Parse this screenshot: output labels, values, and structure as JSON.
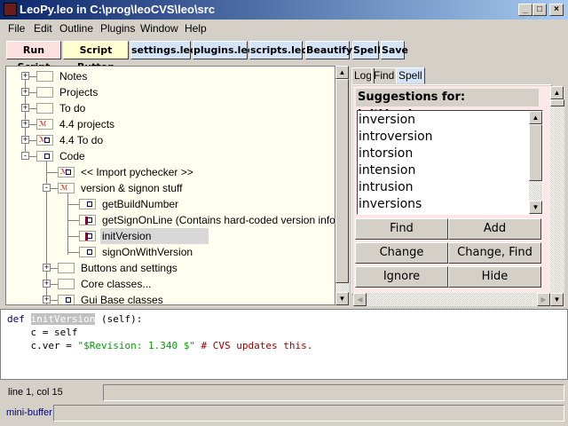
{
  "window": {
    "title": "LeoPy.leo in C:\\prog\\leoCVS\\leo\\src",
    "controls": {
      "minimize": "_",
      "maximize": "□",
      "close": "×"
    }
  },
  "menu": [
    "File",
    "Edit",
    "Outline",
    "Plugins",
    "Window",
    "Help"
  ],
  "toolbar": [
    {
      "label": "Run Script",
      "color": "#fce0e0"
    },
    {
      "label": "Script Button",
      "color": "#ffffd0"
    },
    {
      "label": "settings.leo",
      "color": "#d4e4f8"
    },
    {
      "label": "plugins.leo",
      "color": "#d4e4f8"
    },
    {
      "label": "scripts.leo",
      "color": "#d4e4f8"
    },
    {
      "label": "Beautify",
      "color": "#d4e4f8"
    },
    {
      "label": "Spell",
      "color": "#d4e4f8"
    },
    {
      "label": "Save",
      "color": "#d4e4f8"
    }
  ],
  "outline": [
    {
      "label": "Notes",
      "level": 0,
      "expander": "+",
      "clone": false,
      "body": false,
      "marked": false
    },
    {
      "label": "Projects",
      "level": 0,
      "expander": "+",
      "clone": false,
      "body": false,
      "marked": false
    },
    {
      "label": "To do",
      "level": 0,
      "expander": "+",
      "clone": false,
      "body": false,
      "marked": false
    },
    {
      "label": "4.4 projects",
      "level": 0,
      "expander": "+",
      "clone": true,
      "body": false,
      "marked": false
    },
    {
      "label": "4.4 To do",
      "level": 0,
      "expander": "+",
      "clone": true,
      "body": true,
      "marked": false
    },
    {
      "label": "Code",
      "level": 0,
      "expander": "-",
      "clone": false,
      "body": true,
      "marked": false
    },
    {
      "label": "<< Import pychecker >>",
      "level": 1,
      "expander": "",
      "clone": true,
      "body": true,
      "marked": false
    },
    {
      "label": "version & signon stuff",
      "level": 1,
      "expander": "-",
      "clone": true,
      "body": false,
      "marked": false
    },
    {
      "label": "getBuildNumber",
      "level": 2,
      "expander": "",
      "clone": false,
      "body": true,
      "marked": false
    },
    {
      "label": "getSignOnLine (Contains hard-coded version info)",
      "level": 2,
      "expander": "",
      "clone": false,
      "body": true,
      "marked": true
    },
    {
      "label": "initVersion",
      "level": 2,
      "expander": "",
      "clone": false,
      "body": true,
      "marked": true,
      "selected": true
    },
    {
      "label": "signOnWithVersion",
      "level": 2,
      "expander": "",
      "clone": false,
      "body": true,
      "marked": false
    },
    {
      "label": "Buttons and settings",
      "level": 1,
      "expander": "+",
      "clone": false,
      "body": false,
      "marked": false
    },
    {
      "label": "Core classes...",
      "level": 1,
      "expander": "+",
      "clone": false,
      "body": false,
      "marked": false
    },
    {
      "label": "Gui Base classes",
      "level": 1,
      "expander": "+",
      "clone": false,
      "body": true,
      "marked": false
    }
  ],
  "tabs": [
    {
      "label": "Log"
    },
    {
      "label": "Find"
    },
    {
      "label": "Spell",
      "active": true
    }
  ],
  "spell": {
    "heading": "Suggestions for: initVersion",
    "suggestions": [
      "inversion",
      "introversion",
      "intorsion",
      "intension",
      "intrusion",
      "inversions"
    ],
    "buttons": [
      "Find",
      "Add",
      "Change",
      "Change, Find",
      "Ignore",
      "Hide"
    ]
  },
  "body": {
    "line1": {
      "kw": "def",
      "name": "initVersion",
      "rest": " (self):"
    },
    "line2": "    c = self",
    "line3": {
      "pre": "    c.ver = ",
      "str": "\"$Revision: 1.340 $\"",
      "comment": " # CVS updates this."
    }
  },
  "status": {
    "position": "line 1, col 15",
    "minibuffer_label": "mini-buffer"
  }
}
